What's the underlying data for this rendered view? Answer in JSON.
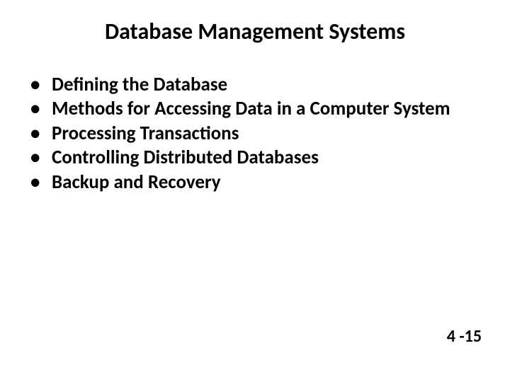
{
  "slide": {
    "title": "Database Management Systems",
    "bullets": [
      "Defining the Database",
      "Methods for Accessing Data in a Computer System",
      "Processing Transactions",
      "Controlling Distributed Databases",
      "Backup and Recovery"
    ],
    "page_number": "4 -15"
  }
}
